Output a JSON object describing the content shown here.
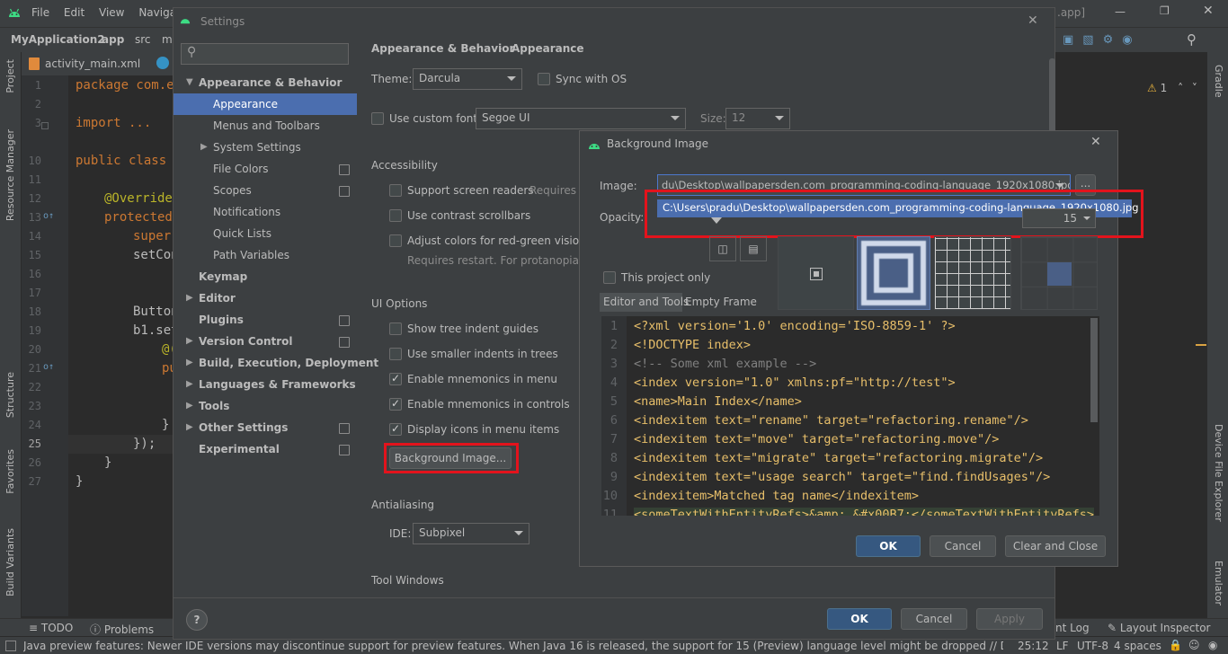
{
  "ide": {
    "menu": [
      "File",
      "Edit",
      "View",
      "Navigate"
    ],
    "title_suffix": ".app]",
    "breadcrumb": [
      "MyApplication2",
      "app",
      "src",
      "m"
    ],
    "editor_tab": "activity_main.xml",
    "left_tools": [
      "Project",
      "Resource Manager",
      "Structure",
      "Favorites",
      "Build Variants"
    ],
    "right_tools": [
      "Gradle",
      "Device File Explorer",
      "Emulator"
    ],
    "warnings": "1",
    "line_numbers": [
      "1",
      "2",
      "3",
      "10",
      "11",
      "12",
      "13",
      "14",
      "15",
      "16",
      "17",
      "18",
      "19",
      "20",
      "21",
      "22",
      "23",
      "24",
      "25",
      "26",
      "27"
    ],
    "code_lines": [
      "package com.ex",
      "",
      "import ...",
      "public class M",
      "",
      "@Override",
      "protected",
      "super.",
      "setCon",
      "",
      "Button",
      "b1.set",
      "@(",
      "pu",
      "",
      "}",
      "});",
      "}",
      "}"
    ],
    "bottom_tools": [
      "TODO",
      "Problems",
      "nt Log",
      "Layout Inspector"
    ],
    "status_text": "Java preview features: Newer IDE versions may discontinue support for preview features. When Java 16 is released, the support for 15 (Preview) language level might be dropped // Do No... (49 minutes ago)",
    "status_right": [
      "25:12",
      "LF",
      "UTF-8",
      "4 spaces"
    ]
  },
  "settings": {
    "title": "Settings",
    "search_placeholder": "",
    "tree": [
      {
        "label": "Appearance & Behavior",
        "bold": true,
        "expanded": true
      },
      {
        "label": "Appearance",
        "selected": true
      },
      {
        "label": "Menus and Toolbars"
      },
      {
        "label": "System Settings"
      },
      {
        "label": "File Colors"
      },
      {
        "label": "Scopes"
      },
      {
        "label": "Notifications"
      },
      {
        "label": "Quick Lists"
      },
      {
        "label": "Path Variables"
      },
      {
        "label": "Keymap",
        "bold": true
      },
      {
        "label": "Editor",
        "bold": true
      },
      {
        "label": "Plugins",
        "bold": true
      },
      {
        "label": "Version Control",
        "bold": true
      },
      {
        "label": "Build, Execution, Deployment",
        "bold": true
      },
      {
        "label": "Languages & Frameworks",
        "bold": true
      },
      {
        "label": "Tools",
        "bold": true
      },
      {
        "label": "Other Settings",
        "bold": true
      },
      {
        "label": "Experimental",
        "bold": true
      }
    ],
    "breadcrumb": [
      "Appearance & Behavior",
      "Appearance"
    ],
    "theme_label": "Theme:",
    "theme_value": "Darcula",
    "sync_os": "Sync with OS",
    "custom_font": "Use custom font:",
    "font_value": "Segoe UI",
    "size_label": "Size:",
    "size_value": "12",
    "accessibility": "Accessibility",
    "screen_readers": "Support screen readers",
    "requires_re": "Requires re",
    "contrast_scrollbars": "Use contrast scrollbars",
    "red_green": "Adjust colors for red-green vision de",
    "restart_note": "Requires restart. For protanopia and",
    "ui_options": "UI Options",
    "tree_indent": "Show tree indent guides",
    "smaller_indents": "Use smaller indents in trees",
    "mnemonics_menu": "Enable mnemonics in menu",
    "mnemonics_controls": "Enable mnemonics in controls",
    "icons_menu": "Display icons in menu items",
    "bg_image_button": "Background Image...",
    "antialiasing": "Antialiasing",
    "ide_label": "IDE:",
    "ide_value": "Subpixel",
    "tool_windows": "Tool Windows",
    "ok": "OK",
    "cancel": "Cancel",
    "apply": "Apply",
    "help": "?"
  },
  "bg_dialog": {
    "title": "Background Image",
    "image_label": "Image:",
    "image_value": "du\\Desktop\\wallpapersden.com_programming-coding-language_1920x1080.jpg",
    "browse": "...",
    "dropdown_option": "C:\\Users\\pradu\\Desktop\\wallpapersden.com_programming-coding-language_1920x1080.jpg",
    "opacity_label": "Opacity:",
    "opacity_value": "15",
    "project_only": "This project only",
    "tab_active": "Editor and Tools",
    "tab_other": "Empty Frame",
    "preview_numbers": [
      "1",
      "2",
      "3",
      "4",
      "5",
      "6",
      "7",
      "8",
      "9",
      "10",
      "11"
    ],
    "preview_code": [
      "<?xml version='1.0' encoding='ISO-8859-1'  ?>",
      "<!DOCTYPE index>",
      "<!-- Some xml example -->",
      "<index version=\"1.0\" xmlns:pf=\"http://test\">",
      "  <name>Main Index</name>",
      "  <indexitem text=\"rename\" target=\"refactoring.rename\"/>",
      "  <indexitem text=\"move\" target=\"refactoring.move\"/>",
      "  <indexitem text=\"migrate\" target=\"refactoring.migrate\"/>",
      "  <indexitem text=\"usage search\" target=\"find.findUsages\"/>",
      "  <indexitem>Matched tag name</indexitem>",
      "  <someTextWithEntityRefs>&amp; &#x00B7;</someTextWithEntityRefs>"
    ],
    "ok": "OK",
    "cancel": "Cancel",
    "clear_close": "Clear and Close"
  },
  "colors": {
    "selection": "#4b6eaf",
    "primary_button": "#365880",
    "highlight_box": "#e3131c"
  }
}
